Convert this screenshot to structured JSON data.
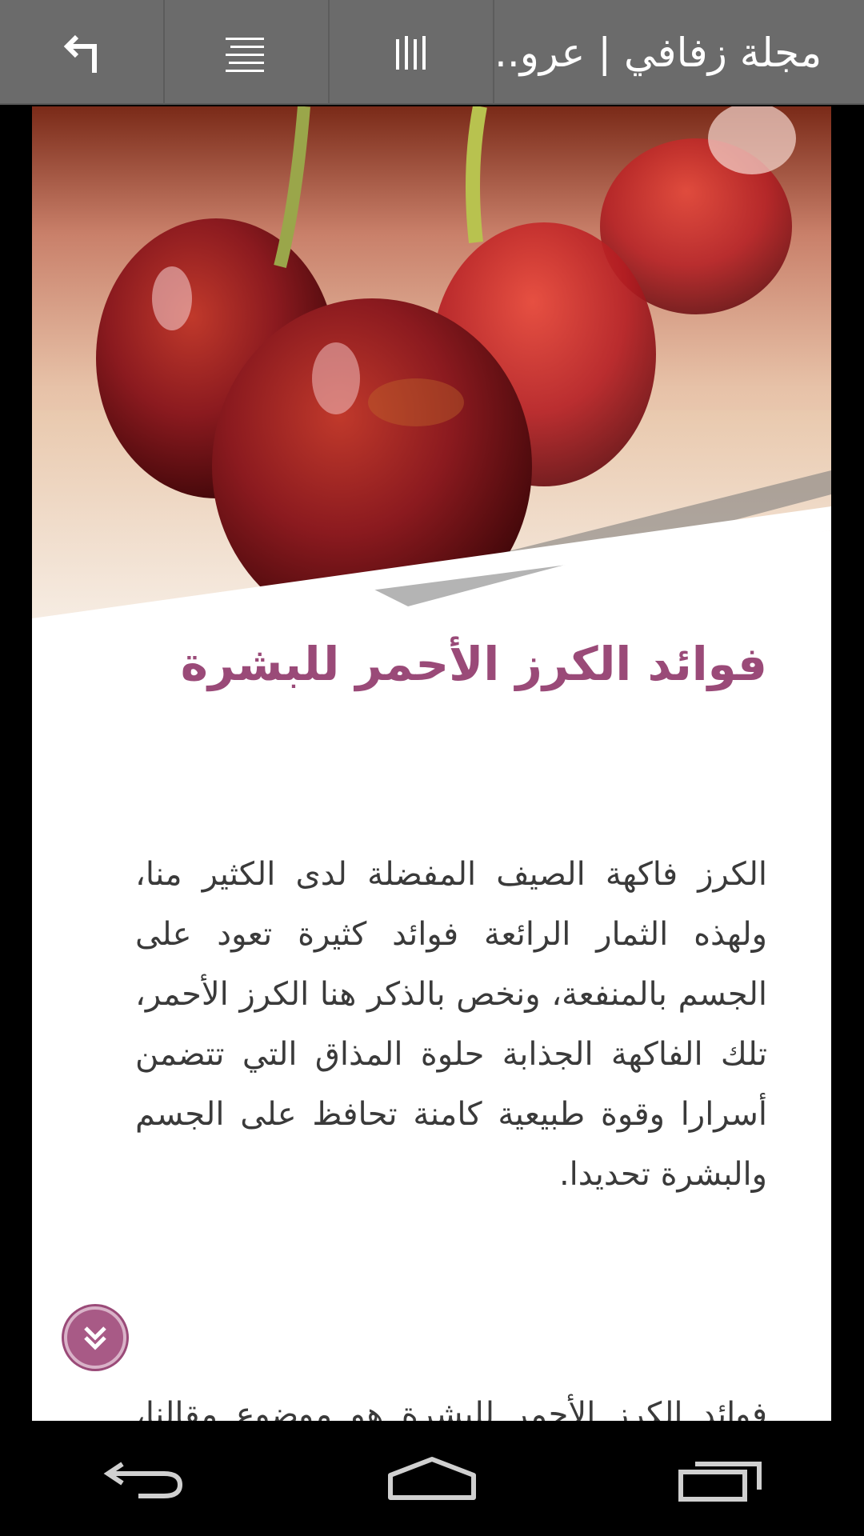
{
  "toolbar": {
    "title": "مجلة زفافي | عرو..",
    "icons": [
      "back-arrow-icon",
      "align-text-icon",
      "columns-icon"
    ]
  },
  "article": {
    "title": "فوائد الكرز الأحمر للبشرة",
    "paragraph1": "الكرز فاكهة الصيف المفضلة لدى الكثير منا، ولهذه الثمار الرائعة فوائد كثيرة تعود على الجسم بالمنفعة، ونخص بالذكر هنا الكرز الأحمر، تلك الفاكهة الجذابة حلوة المذاق التي تتضمن أسرارا وقوة طبيعية كامنة تحافظ على الجسم والبشرة تحديدا.",
    "paragraph2": "فوائد الكرز الأحمر للبشرة هو موضوع مقالنا، حيث أن الكرز الأحمر سر من أسرار الجمال التي تخفيها الكثير من النساء من"
  },
  "colors": {
    "toolbar": "#6b6b6b",
    "accent": "#9a4a78",
    "text": "#3a3a3a"
  },
  "nav": {
    "icons": [
      "nav-back-icon",
      "nav-home-icon",
      "nav-recents-icon"
    ]
  }
}
